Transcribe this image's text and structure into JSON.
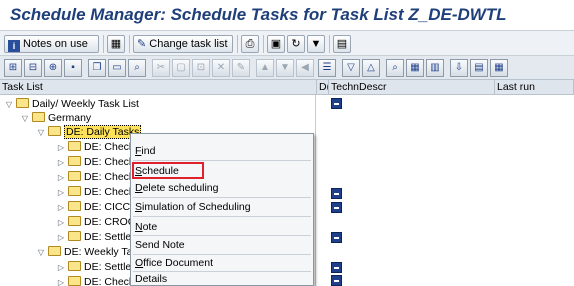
{
  "title": "Schedule Manager: Schedule Tasks for Task List Z_DE-DWTL",
  "toolbar": {
    "notes_label": "Notes on use",
    "change_label": "Change task list"
  },
  "columns": {
    "task_list": "Task List",
    "d": "D(",
    "techn_descr": "TechnDescr",
    "last_run": "Last run"
  },
  "tree": {
    "root": "Daily/ Weekly Task List",
    "country": "Germany",
    "daily": "DE: Daily Tasks",
    "daily_items": [
      "DE: Check F",
      "DE: Check V",
      "DE: Check b",
      "DE: Check l",
      "DE: CICC In",
      "DE: CROCO",
      "DE: Settlem"
    ],
    "weekly": "DE: Weekly Tas",
    "weekly_items": [
      "DE: Settlem",
      "DE: Check C"
    ]
  },
  "context_menu": {
    "items": [
      {
        "mnemonic": "F",
        "rest": "ind"
      },
      {
        "mnemonic": "S",
        "rest": "chedule"
      },
      {
        "mnemonic": "D",
        "rest": "elete scheduling"
      },
      {
        "mnemonic": "S",
        "rest": "imulation of Scheduling"
      },
      {
        "mnemonic": "N",
        "rest": "ote"
      },
      {
        "mnemonic": "",
        "rest": "Send Note"
      },
      {
        "mnemonic": "O",
        "rest": "ffice Document"
      },
      {
        "mnemonic": "",
        "rest": "Details"
      }
    ],
    "highlighted": "Schedule"
  },
  "icons": {
    "info": "i",
    "scheduled_marker": "scheduled-task-icon"
  },
  "colors": {
    "title": "#1f3f7a",
    "selection": "#fde25a",
    "highlight_box": "#e0202c"
  }
}
